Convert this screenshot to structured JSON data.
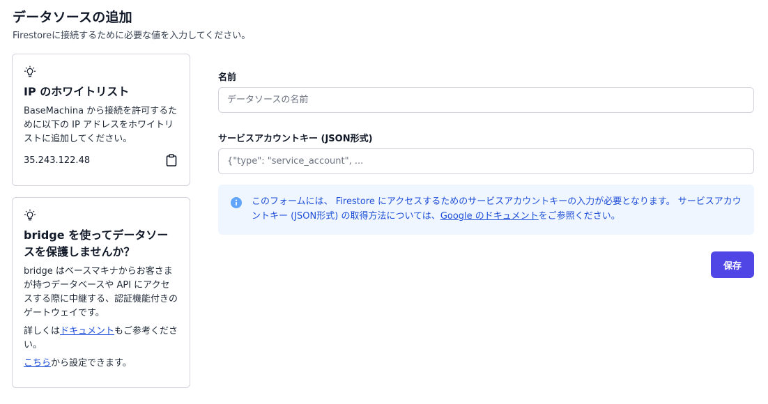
{
  "header": {
    "title": "データソースの追加",
    "subtitle": "Firestoreに接続するために必要な値を入力してください。"
  },
  "ip_card": {
    "icon": "lightbulb-icon",
    "title": "IP のホワイトリスト",
    "description": "BaseMachina から接続を許可するために以下の IP アドレスをホワイトリストに追加してください。",
    "ip_address": "35.243.122.48",
    "copy_icon": "clipboard-icon"
  },
  "bridge_card": {
    "icon": "lightbulb-icon",
    "title": "bridge を使ってデータソースを保護しませんか？",
    "description": "bridge はベースマキナからお客さまが持つデータベースや API にアクセスする際に中継する、認証機能付きのゲートウェイです。",
    "docs_prefix": "詳しくは",
    "docs_link": "ドキュメント",
    "docs_suffix": "もご参考ください。",
    "settings_link": "こちら",
    "settings_suffix": "から設定できます。"
  },
  "form": {
    "name_label": "名前",
    "name_placeholder": "データソースの名前",
    "key_label": "サービスアカウントキー (JSON形式)",
    "key_placeholder": "{\"type\": \"service_account\", ..."
  },
  "notice": {
    "icon": "info-icon",
    "text_before": "このフォームには、 Firestore にアクセスするためのサービスアカウントキーの入力が必要となります。 サービスアカウントキー (JSON形式) の取得方法については、",
    "link": "Google のドキュメント",
    "text_after": "をご参照ください。",
    "color": "#1d4ed8",
    "background": "#eff6ff"
  },
  "actions": {
    "save_label": "保存",
    "save_color": "#4f46e5"
  }
}
